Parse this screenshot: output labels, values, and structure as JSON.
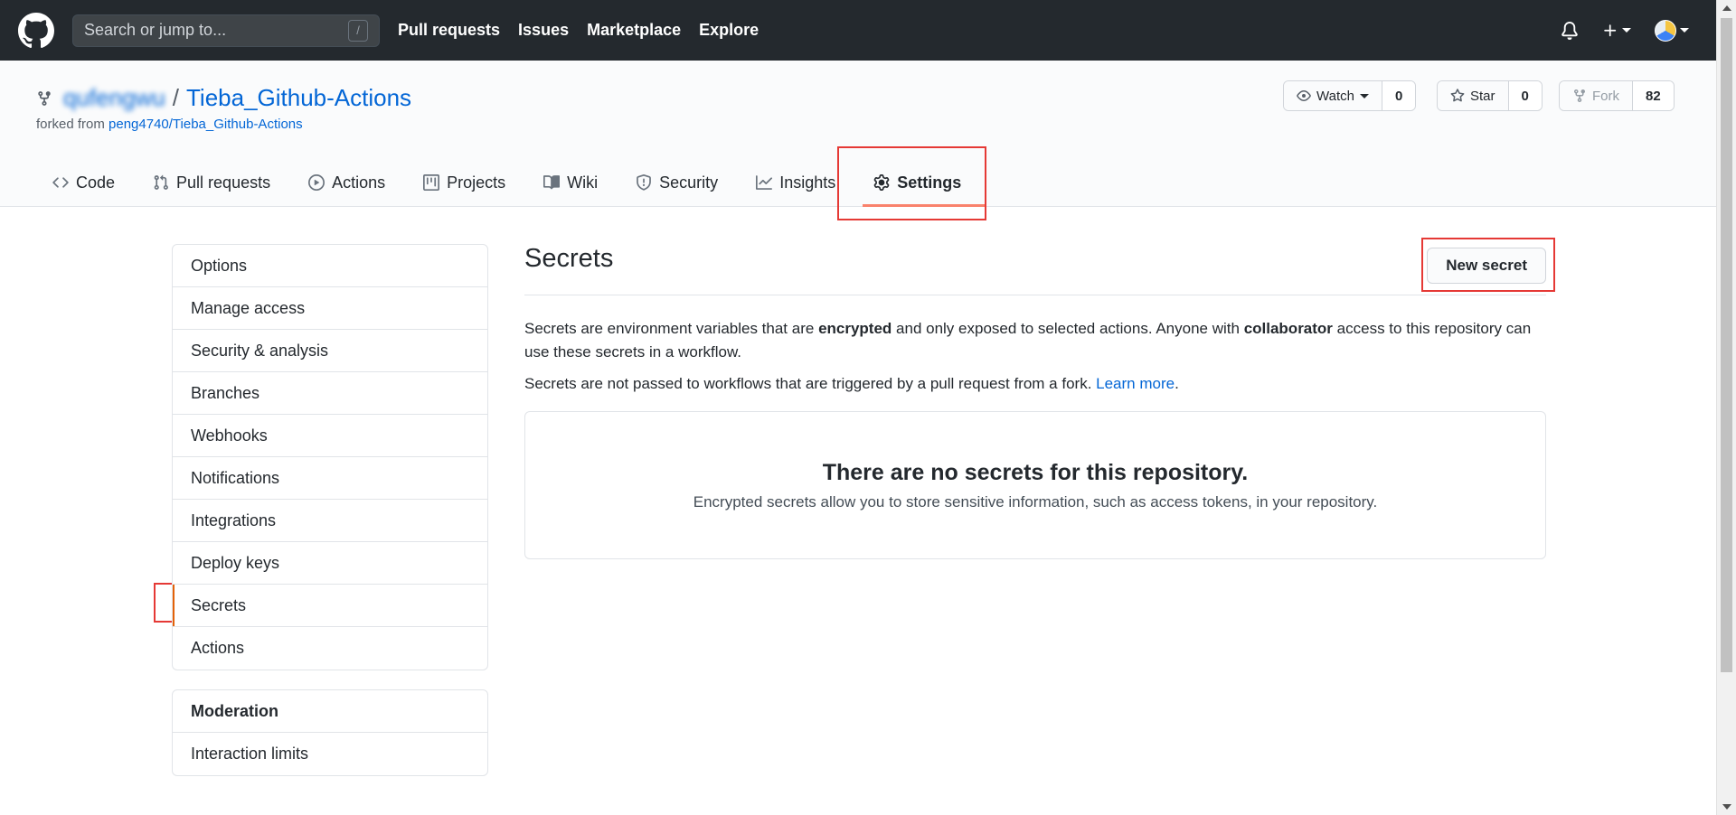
{
  "topbar": {
    "search_placeholder": "Search or jump to...",
    "search_shortcut": "/",
    "nav": [
      "Pull requests",
      "Issues",
      "Marketplace",
      "Explore"
    ]
  },
  "repo": {
    "owner": "qufengwu",
    "separator": "/",
    "name": "Tieba_Github-Actions",
    "forked_prefix": "forked from",
    "forked_link": "peng4740/Tieba_Github-Actions",
    "watch_label": "Watch",
    "watch_count": "0",
    "star_label": "Star",
    "star_count": "0",
    "fork_label": "Fork",
    "fork_count": "82"
  },
  "tabs": [
    {
      "label": "Code",
      "icon": "code-icon"
    },
    {
      "label": "Pull requests",
      "icon": "pull-request-icon"
    },
    {
      "label": "Actions",
      "icon": "play-icon"
    },
    {
      "label": "Projects",
      "icon": "project-icon"
    },
    {
      "label": "Wiki",
      "icon": "book-icon"
    },
    {
      "label": "Security",
      "icon": "shield-icon"
    },
    {
      "label": "Insights",
      "icon": "graph-icon"
    },
    {
      "label": "Settings",
      "icon": "gear-icon"
    }
  ],
  "sidebar": {
    "items": [
      "Options",
      "Manage access",
      "Security & analysis",
      "Branches",
      "Webhooks",
      "Notifications",
      "Integrations",
      "Deploy keys",
      "Secrets",
      "Actions"
    ],
    "moderation_title": "Moderation",
    "moderation_items": [
      "Interaction limits"
    ]
  },
  "main": {
    "title": "Secrets",
    "new_button": "New secret",
    "desc_part1": "Secrets are environment variables that are ",
    "desc_bold1": "encrypted",
    "desc_part2": " and only exposed to selected actions. Anyone with ",
    "desc_bold2": "collaborator",
    "desc_part3": " access to this repository can use these secrets in a workflow.",
    "desc2_text": "Secrets are not passed to workflows that are triggered by a pull request from a fork. ",
    "desc2_link": "Learn more",
    "desc2_end": ".",
    "blank_title": "There are no secrets for this repository.",
    "blank_text": "Encrypted secrets allow you to store sensitive information, such as access tokens, in your repository."
  },
  "colors": {
    "header_bg": "#24292e",
    "link": "#0366d6",
    "active_tab_underline": "#f9826c",
    "highlight_box": "#e53935"
  }
}
